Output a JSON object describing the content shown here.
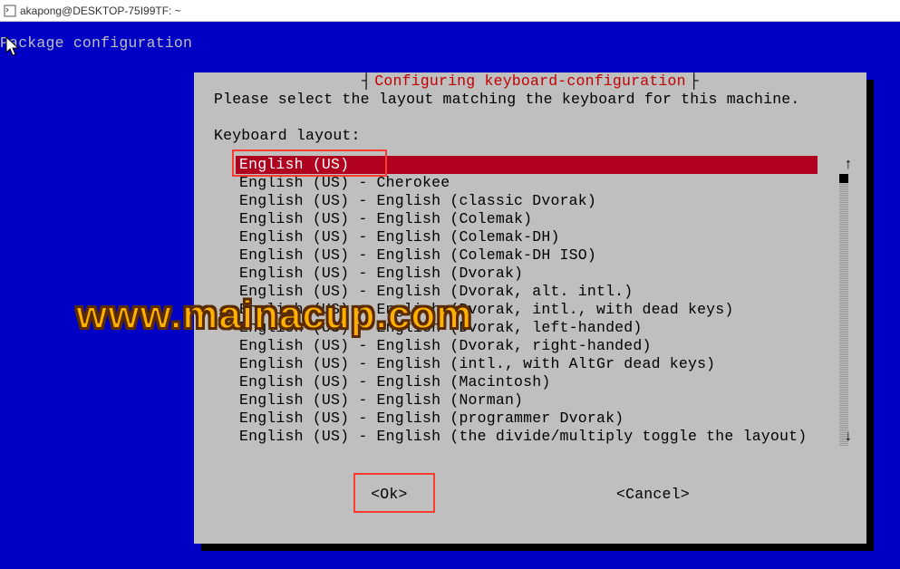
{
  "window": {
    "title": "akapong@DESKTOP-75I99TF: ~"
  },
  "header_text": "Package configuration",
  "dialog": {
    "title": "Configuring keyboard-configuration",
    "instruction": "Please select the layout matching the keyboard for this machine.",
    "label": "Keyboard layout:",
    "items": [
      "English (US)",
      "English (US) - Cherokee",
      "English (US) - English (classic Dvorak)",
      "English (US) - English (Colemak)",
      "English (US) - English (Colemak-DH)",
      "English (US) - English (Colemak-DH ISO)",
      "English (US) - English (Dvorak)",
      "English (US) - English (Dvorak, alt. intl.)",
      "English (US) - English (Dvorak, intl., with dead keys)",
      "English (US) - English (Dvorak, left-handed)",
      "English (US) - English (Dvorak, right-handed)",
      "English (US) - English (intl., with AltGr dead keys)",
      "English (US) - English (Macintosh)",
      "English (US) - English (Norman)",
      "English (US) - English (programmer Dvorak)",
      "English (US) - English (the divide/multiply toggle the layout)"
    ],
    "selected_index": 0,
    "ok_label": "<Ok>",
    "cancel_label": "<Cancel>",
    "scroll_up": "↑",
    "scroll_down": "↓"
  },
  "watermark": "www.mainacup.com"
}
